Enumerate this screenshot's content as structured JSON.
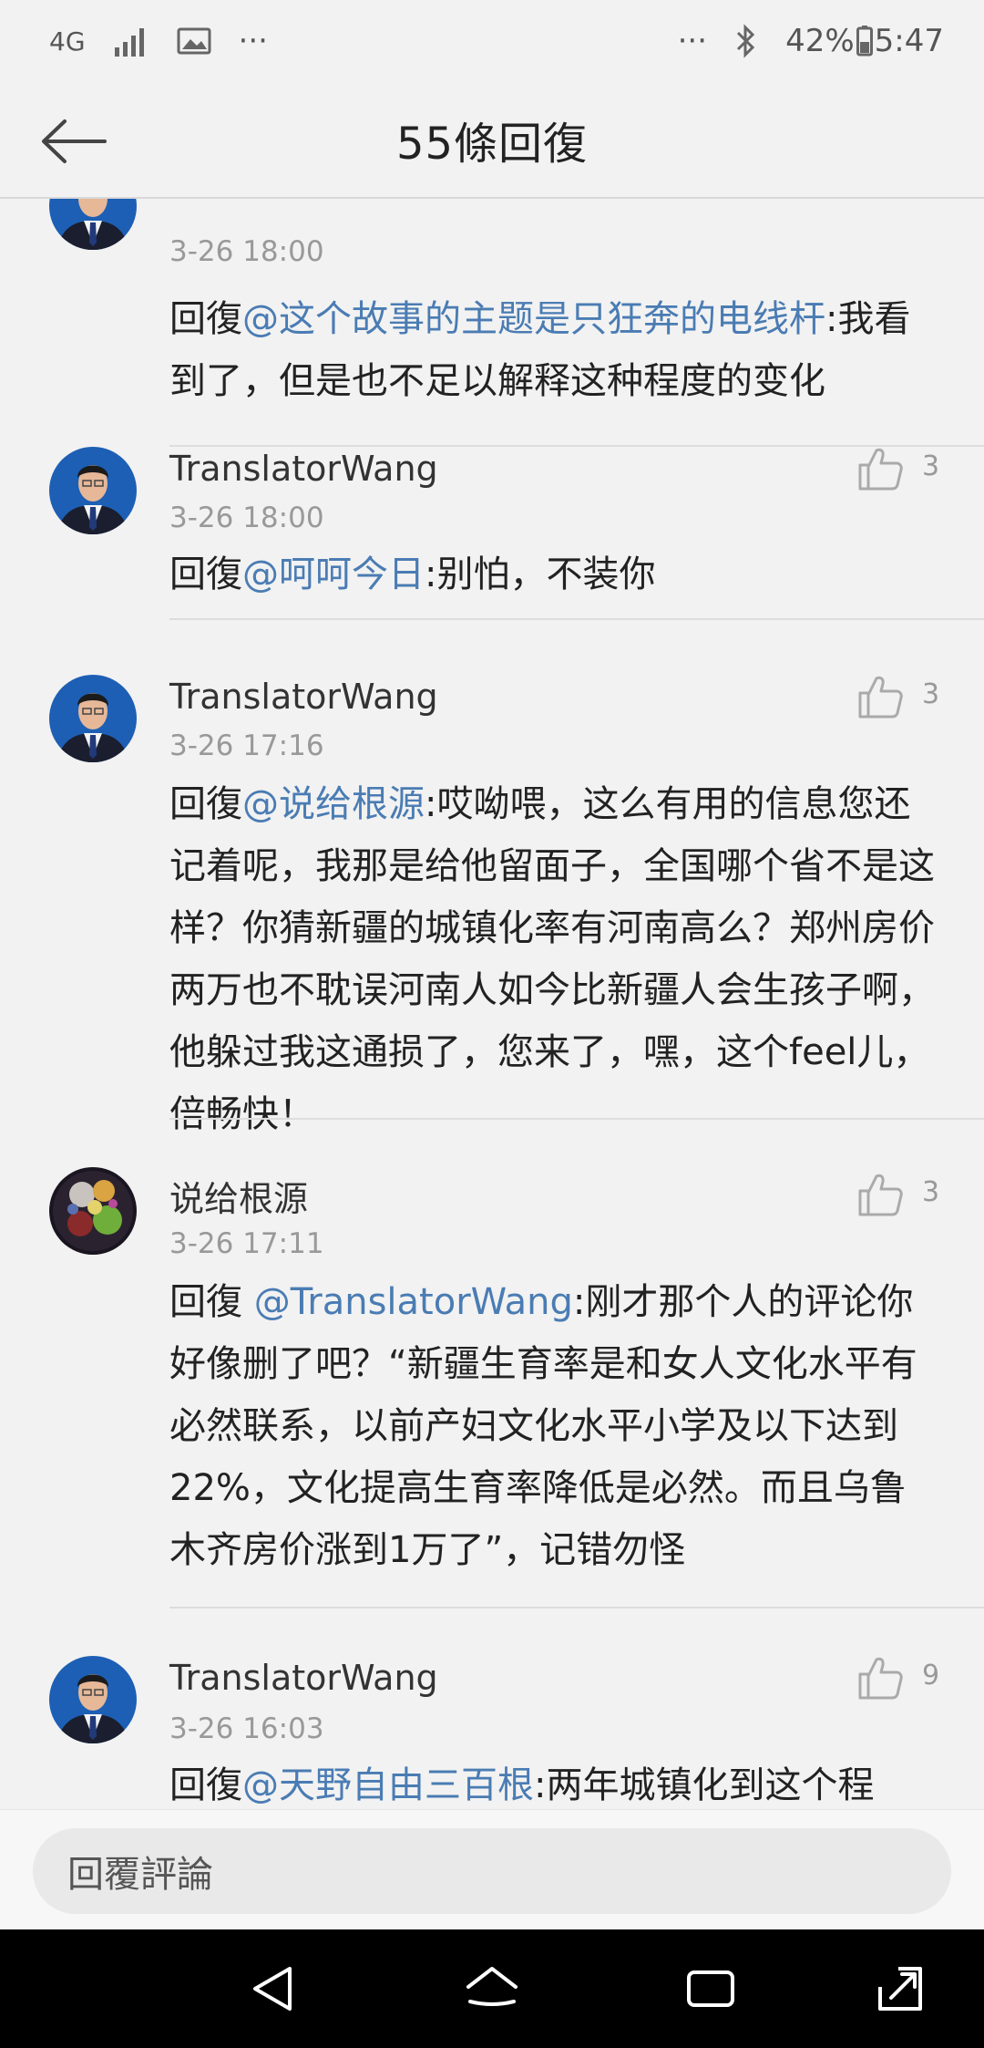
{
  "status_bar": {
    "network": "4G",
    "more": "···",
    "battery": "42%",
    "time": "5:47"
  },
  "header": {
    "title": "55條回復"
  },
  "comments": [
    {
      "name": "",
      "time": "3-26 18:00",
      "prefix": "回復",
      "mention": "@这个故事的主题是只狂奔的电线杆",
      "text": ":我看到了，但是也不足以解释这种程度的变化"
    },
    {
      "name": "TranslatorWang",
      "time": "3-26 18:00",
      "likes": "3",
      "prefix": "回復",
      "mention": "@呵呵今日",
      "text": ":别怕，不装你"
    },
    {
      "name": "TranslatorWang",
      "time": "3-26 17:16",
      "likes": "3",
      "prefix": "回復",
      "mention": "@说给根源",
      "text": ":哎呦喂，这么有用的信息您还记着呢，我那是给他留面子，全国哪个省不是这样？你猜新疆的城镇化率有河南高么？郑州房价两万也不耽误河南人如今比新疆人会生孩子啊，他躲过我这通损了，您来了，嘿，这个feel儿，倍畅快！"
    },
    {
      "name": "说给根源",
      "time": "3-26 17:11",
      "likes": "3",
      "prefix": "回復 ",
      "mention": "@TranslatorWang",
      "text": ":刚才那个人的评论你好像删了吧？“新疆生育率是和女人文化水平有必然联系，以前产妇文化水平小学及以下达到22%，文化提高生育率降低是必然。而且乌鲁木齐房价涨到1万了”，记错勿怪"
    },
    {
      "name": "TranslatorWang",
      "time": "3-26 16:03",
      "likes": "9",
      "prefix": "回復",
      "mention": "@天野自由三百根",
      "text": ":两年城镇化到这个程"
    }
  ],
  "input": {
    "placeholder": "回覆評論"
  },
  "colors": {
    "mention": "#4a7cb3",
    "background": "#f2f2f2",
    "nav_bar": "#000000"
  }
}
